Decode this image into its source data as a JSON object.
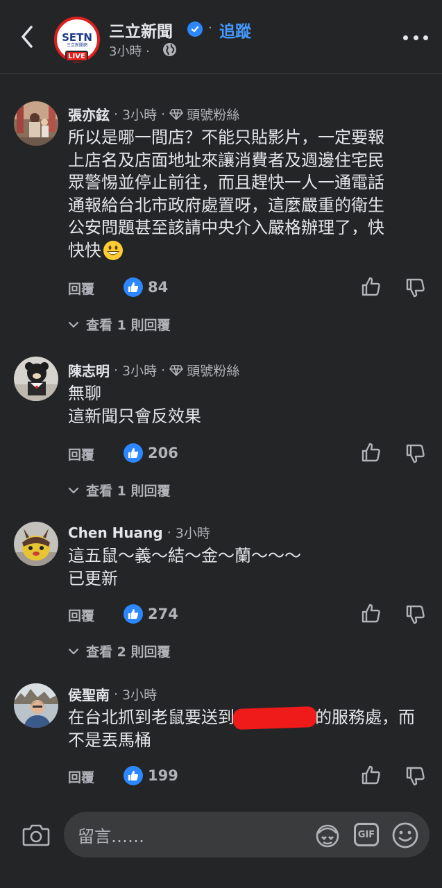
{
  "header": {
    "page_name": "三立新聞",
    "separator": "·",
    "follow_label": "追蹤",
    "time": "3小時 ·",
    "logo_text": "SETN",
    "logo_subtext": "三立新聞網",
    "live_label": "LIVE"
  },
  "comments": [
    {
      "name": "張亦鉉",
      "time": "3小時",
      "badge": "頭號粉絲",
      "body_lines": [
        "所以是哪一間店？不能只貼影片，一定要報",
        "上店名及店面地址來讓消費者及週邊住宅民",
        "眾警惕並停止前往，而且趕快一人一通電話",
        "通報給台北市政府處置呀，這麼嚴重的衛生",
        "公安問題甚至該請中央介入嚴格辦理了，快",
        "快快"
      ],
      "emoji": "grinning-face-emoji",
      "reply_label": "回覆",
      "likes": "84",
      "view_replies": "查看 1 則回覆"
    },
    {
      "name": "陳志明",
      "time": "3小時",
      "badge": "頭號粉絲",
      "body_lines": [
        "無聊",
        "這新聞只會反效果"
      ],
      "reply_label": "回覆",
      "likes": "206",
      "view_replies": "查看 1 則回覆"
    },
    {
      "name": "Chen Huang",
      "time": "3小時",
      "body_lines": [
        "這五鼠～義～結～金～蘭～～～",
        "已更新"
      ],
      "reply_label": "回覆",
      "likes": "274",
      "view_replies": "查看 2 則回覆"
    },
    {
      "name": "侯聖南",
      "time": "3小時",
      "body_line1_before": "在台北抓到老鼠要送到",
      "body_line1_after": "的服務處，而",
      "body_line2": "不是丟馬桶",
      "reply_label": "回覆",
      "likes": "199"
    }
  ],
  "composer": {
    "placeholder": "留言……",
    "gif_label": "GIF"
  },
  "colors": {
    "background": "#242526",
    "text_primary": "#e4e6eb",
    "text_secondary": "#b0b3b8",
    "link_blue": "#4599ff",
    "like_blue": "#2d88ff",
    "live_red": "#e02020"
  }
}
